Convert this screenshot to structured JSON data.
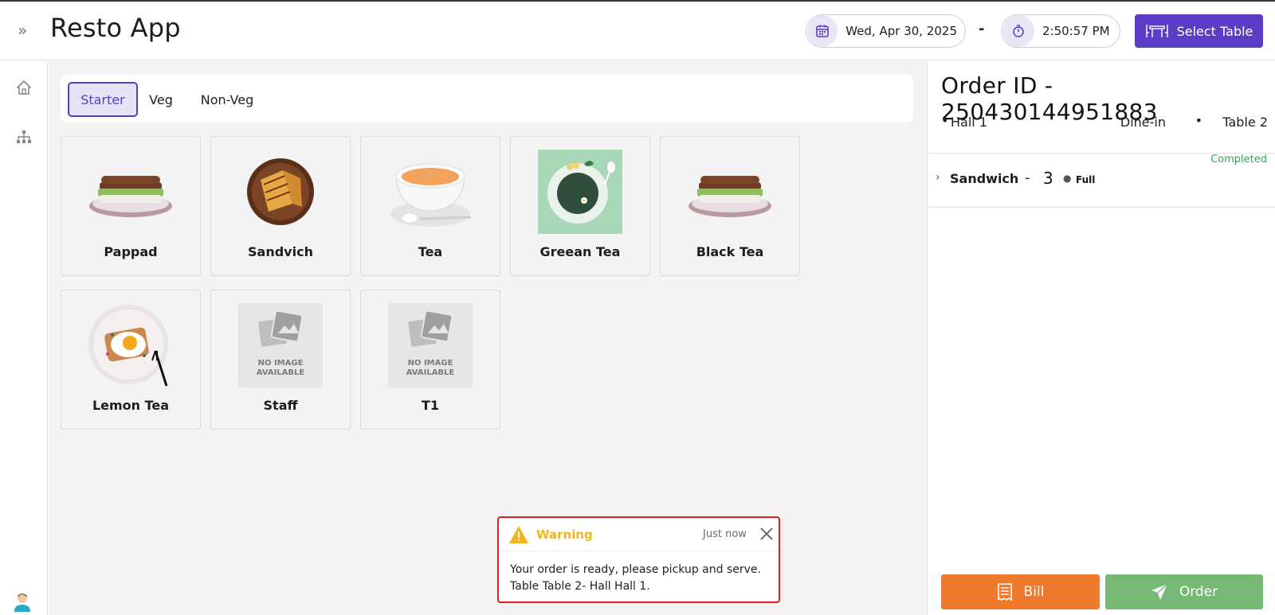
{
  "header": {
    "app_title": "Resto App",
    "date": "Wed, Apr 30, 2025",
    "separator": "-",
    "time": "2:50:57 PM",
    "select_table_label": "Select Table"
  },
  "sidebar": {
    "items": [
      {
        "icon": "home-icon"
      },
      {
        "icon": "sitemap-icon"
      }
    ],
    "avatar_icon": "user-avatar-icon"
  },
  "tabs": [
    {
      "label": "Starter",
      "active": true
    },
    {
      "label": "Veg",
      "active": false
    },
    {
      "label": "Non-Veg",
      "active": false
    }
  ],
  "menu_items": [
    {
      "label": "Pappad",
      "image": "sandwich-photo"
    },
    {
      "label": "Sandvich",
      "image": "grilled-sandwich-photo"
    },
    {
      "label": "Tea",
      "image": "tea-cup-photo"
    },
    {
      "label": "Greean Tea",
      "image": "green-tea-photo"
    },
    {
      "label": "Black Tea",
      "image": "sandwich-photo"
    },
    {
      "label": "Lemon Tea",
      "image": "egg-toast-photo"
    },
    {
      "label": "Staff",
      "image": "no-image-placeholder"
    },
    {
      "label": "T1",
      "image": "no-image-placeholder"
    }
  ],
  "placeholder": {
    "line1": "NO IMAGE",
    "line2": "AVAILABLE"
  },
  "order": {
    "title": "Order ID - 250430144951883",
    "hall": "Hall 1",
    "service": "Dine-in",
    "table": "Table 2",
    "status": "Completed",
    "items": [
      {
        "name": "Sandwich",
        "separator": "-",
        "qty": "3",
        "portion": "Full"
      }
    ],
    "bill_label": "Bill",
    "order_label": "Order"
  },
  "toast": {
    "title": "Warning",
    "time": "Just now",
    "message": "Your order is ready, please pickup and serve. Table Table 2- Hall Hall 1."
  },
  "colors": {
    "accent": "#5b3cc4",
    "bill": "#ef7a2b",
    "order": "#77b877",
    "completed": "#3aa35a",
    "warning": "#f3b51e",
    "toast_border": "#e31c1c"
  }
}
